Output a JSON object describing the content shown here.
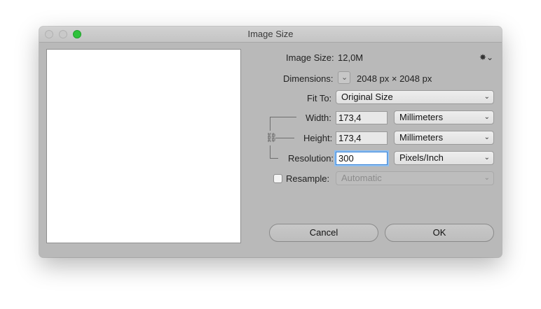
{
  "window": {
    "title": "Image Size"
  },
  "info": {
    "image_size_label": "Image Size:",
    "image_size_value": "12,0M",
    "dimensions_label": "Dimensions:",
    "dimensions_value": "2048 px  ×  2048 px",
    "settings_icon": "gear-icon",
    "settings_glyph": "✸⌄"
  },
  "fit_to": {
    "label": "Fit To:",
    "selected": "Original Size"
  },
  "width": {
    "label": "Width:",
    "value": "173,4",
    "unit": "Millimeters"
  },
  "height": {
    "label": "Height:",
    "value": "173,4",
    "unit": "Millimeters"
  },
  "resolution": {
    "label": "Resolution:",
    "value": "300",
    "unit": "Pixels/Inch"
  },
  "resample": {
    "label": "Resample:",
    "checked": false,
    "selected": "Automatic"
  },
  "buttons": {
    "cancel": "Cancel",
    "ok": "OK"
  },
  "icons": {
    "chevron": "⌄",
    "link": "⛓"
  },
  "colors": {
    "window_bg": "#b9b9b9",
    "zoom_button": "#2fc23b",
    "focus_ring": "#3a84d8"
  }
}
